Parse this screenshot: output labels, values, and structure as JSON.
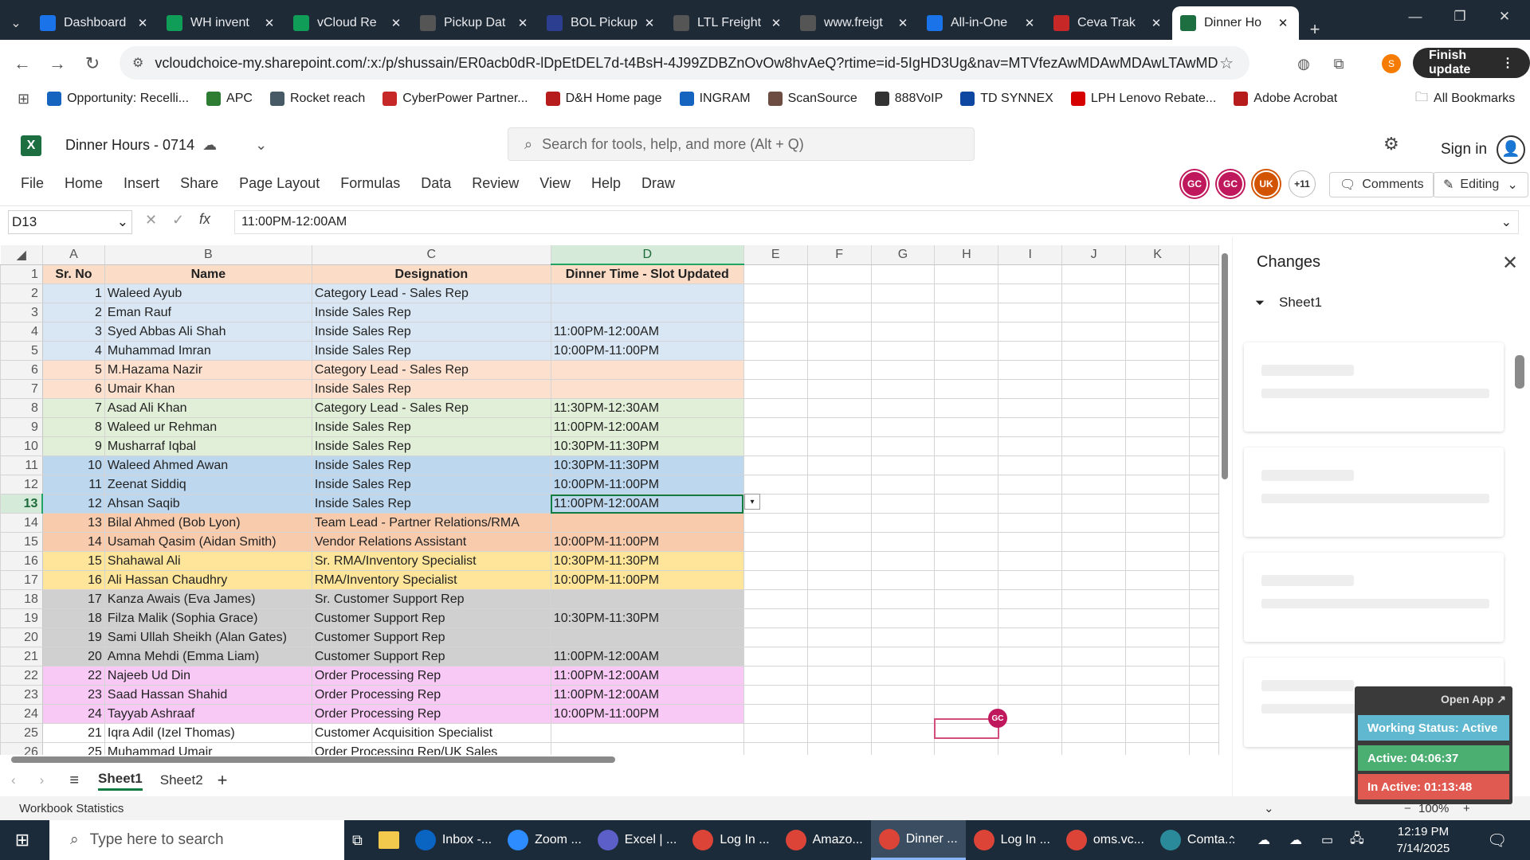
{
  "browser": {
    "tabs": [
      {
        "title": "Dashboard",
        "icon": "dashboard-icon",
        "color": "#1a73e8"
      },
      {
        "title": "WH invent",
        "icon": "sheets-icon",
        "color": "#0f9d58"
      },
      {
        "title": "vCloud Re",
        "icon": "sheets-icon",
        "color": "#0f9d58"
      },
      {
        "title": "Pickup Dat",
        "icon": "globe-icon",
        "color": "#555555"
      },
      {
        "title": "BOL Pickup",
        "icon": "bol-icon",
        "color": "#2c3e90"
      },
      {
        "title": "LTL Freight",
        "icon": "globe-icon",
        "color": "#555555"
      },
      {
        "title": "www.freigt",
        "icon": "fcc-icon",
        "color": "#555555"
      },
      {
        "title": "All-in-One",
        "icon": "seventeen-icon",
        "color": "#1a73e8"
      },
      {
        "title": "Ceva Trak",
        "icon": "ceva-icon",
        "color": "#c62828"
      },
      {
        "title": "Dinner Ho",
        "icon": "excel-icon",
        "color": "#1d6f42"
      }
    ],
    "url": "vcloudchoice-my.sharepoint.com/:x:/p/shussain/ER0acb0dR-lDpEtDEL7d-t4BsH-4J99ZDBZnOvOw8hvAeQ?rtime=id-5IgHD3Ug&nav=MTVfezAwMDAwMDAwLTAwMDEtMA...",
    "finish_update": "Finish update",
    "profile_initial": "S",
    "bookmarks": [
      {
        "label": "Opportunity: Recelli...",
        "color": "#1565c0"
      },
      {
        "label": "APC",
        "color": "#2e7d32"
      },
      {
        "label": "Rocket reach",
        "color": "#455a64"
      },
      {
        "label": "CyberPower Partner...",
        "color": "#c62828"
      },
      {
        "label": "D&H Home page",
        "color": "#b71c1c"
      },
      {
        "label": "INGRAM",
        "color": "#1565c0"
      },
      {
        "label": "ScanSource",
        "color": "#6d4c41"
      },
      {
        "label": "888VoIP",
        "color": "#333333"
      },
      {
        "label": "TD SYNNEX",
        "color": "#0d47a1"
      },
      {
        "label": "LPH Lenovo Rebate...",
        "color": "#d50000"
      },
      {
        "label": "Adobe Acrobat",
        "color": "#b71c1c"
      }
    ],
    "all_bookmarks": "All Bookmarks"
  },
  "excel": {
    "logo": "X",
    "doc_title": "Dinner Hours - 0714",
    "search_placeholder": "Search for tools, help, and more (Alt + Q)",
    "sign_in": "Sign in",
    "menu": [
      "File",
      "Home",
      "Insert",
      "Share",
      "Page Layout",
      "Formulas",
      "Data",
      "Review",
      "View",
      "Help",
      "Draw"
    ],
    "collaborators": [
      {
        "initials": "GC",
        "color": "#c0185c"
      },
      {
        "initials": "GC",
        "color": "#c0185c"
      },
      {
        "initials": "UK",
        "color": "#d35400"
      },
      {
        "initials": "+11",
        "color": "#ffffff"
      }
    ],
    "comments_label": "Comments",
    "editing_label": "Editing",
    "name_box": "D13",
    "formula_value": "11:00PM-12:00AM",
    "columns": [
      "A",
      "B",
      "C",
      "D",
      "E",
      "F",
      "G",
      "H",
      "I",
      "J",
      "K"
    ],
    "header_row": {
      "a": "Sr. No",
      "b": "Name",
      "c": "Designation",
      "d": "Dinner Time - Slot Updated"
    },
    "rows": [
      {
        "r": 2,
        "a": "1",
        "b": "Waleed Ayub",
        "c": "Category Lead - Sales Rep",
        "d": "",
        "color": "blue"
      },
      {
        "r": 3,
        "a": "2",
        "b": "Eman Rauf",
        "c": "Inside Sales Rep",
        "d": "",
        "color": "blue"
      },
      {
        "r": 4,
        "a": "3",
        "b": "Syed Abbas Ali Shah",
        "c": "Inside Sales Rep",
        "d": "11:00PM-12:00AM",
        "color": "blue"
      },
      {
        "r": 5,
        "a": "4",
        "b": "Muhammad Imran",
        "c": "Inside Sales Rep",
        "d": "10:00PM-11:00PM",
        "color": "blue"
      },
      {
        "r": 6,
        "a": "5",
        "b": "M.Hazama Nazir",
        "c": "Category Lead - Sales Rep",
        "d": "",
        "color": "peach"
      },
      {
        "r": 7,
        "a": "6",
        "b": "Umair Khan",
        "c": "Inside Sales Rep",
        "d": "",
        "color": "peach"
      },
      {
        "r": 8,
        "a": "7",
        "b": "Asad Ali Khan",
        "c": "Category Lead - Sales Rep",
        "d": "11:30PM-12:30AM",
        "color": "green"
      },
      {
        "r": 9,
        "a": "8",
        "b": "Waleed ur Rehman",
        "c": "Inside Sales Rep",
        "d": "11:00PM-12:00AM",
        "color": "green"
      },
      {
        "r": 10,
        "a": "9",
        "b": "Musharraf Iqbal",
        "c": "Inside Sales Rep",
        "d": "10:30PM-11:30PM",
        "color": "green"
      },
      {
        "r": 11,
        "a": "10",
        "b": "Waleed Ahmed Awan",
        "c": "Inside Sales Rep",
        "d": "10:30PM-11:30PM",
        "color": "darkblue"
      },
      {
        "r": 12,
        "a": "11",
        "b": "Zeenat Siddiq",
        "c": "Inside Sales Rep",
        "d": "10:00PM-11:00PM",
        "color": "darkblue"
      },
      {
        "r": 13,
        "a": "12",
        "b": "Ahsan Saqib",
        "c": "Inside Sales Rep",
        "d": "11:00PM-12:00AM",
        "color": "darkblue"
      },
      {
        "r": 14,
        "a": "13",
        "b": "Bilal Ahmed (Bob Lyon)",
        "c": "Team Lead - Partner Relations/RMA",
        "d": "",
        "color": "orange"
      },
      {
        "r": 15,
        "a": "14",
        "b": "Usamah Qasim (Aidan Smith)",
        "c": "Vendor Relations Assistant",
        "d": "10:00PM-11:00PM",
        "color": "orange"
      },
      {
        "r": 16,
        "a": "15",
        "b": "Shahawal Ali",
        "c": "Sr. RMA/Inventory Specialist",
        "d": "10:30PM-11:30PM",
        "color": "yellow"
      },
      {
        "r": 17,
        "a": "16",
        "b": "Ali Hassan Chaudhry",
        "c": "RMA/Inventory Specialist",
        "d": "10:00PM-11:00PM",
        "color": "yellow"
      },
      {
        "r": 18,
        "a": "17",
        "b": "Kanza Awais (Eva James)",
        "c": "Sr. Customer Support Rep",
        "d": "",
        "color": "gray"
      },
      {
        "r": 19,
        "a": "18",
        "b": "Filza Malik (Sophia Grace)",
        "c": "Customer Support Rep",
        "d": "10:30PM-11:30PM",
        "color": "gray"
      },
      {
        "r": 20,
        "a": "19",
        "b": "Sami Ullah Sheikh (Alan Gates)",
        "c": "Customer Support Rep",
        "d": "",
        "color": "gray"
      },
      {
        "r": 21,
        "a": "20",
        "b": "Amna Mehdi (Emma Liam)",
        "c": "Customer Support Rep",
        "d": "11:00PM-12:00AM",
        "color": "gray"
      },
      {
        "r": 22,
        "a": "22",
        "b": "Najeeb Ud Din",
        "c": "Order Processing Rep",
        "d": "11:00PM-12:00AM",
        "color": "pink"
      },
      {
        "r": 23,
        "a": "23",
        "b": "Saad Hassan Shahid",
        "c": "Order Processing Rep",
        "d": "11:00PM-12:00AM",
        "color": "pink"
      },
      {
        "r": 24,
        "a": "24",
        "b": "Tayyab Ashraaf",
        "c": "Order Processing Rep",
        "d": "10:00PM-11:00PM",
        "color": "pink"
      },
      {
        "r": 25,
        "a": "21",
        "b": "Iqra Adil (Izel Thomas)",
        "c": "Customer Acquisition Specialist",
        "d": "",
        "color": "white"
      },
      {
        "r": 26,
        "a": "25",
        "b": "Muhammad Umair",
        "c": "Order Processing Rep/UK Sales",
        "d": "",
        "color": "white"
      }
    ],
    "selected_row": 13,
    "sheets": [
      "Sheet1",
      "Sheet2"
    ],
    "status_left": "Workbook Statistics",
    "zoom": "100%",
    "cell_marker": "GC"
  },
  "changes_panel": {
    "title": "Changes",
    "filter_label": "Sheet1"
  },
  "status_widget": {
    "open_app": "Open App ↗",
    "working": "Working Status: Active",
    "active": "Active: 04:06:37",
    "inactive": "In Active: 01:13:48"
  },
  "taskbar": {
    "search_placeholder": "Type here to search",
    "apps": [
      {
        "label": "Inbox -...",
        "icon": "outlook-icon",
        "color": "#0a64c2"
      },
      {
        "label": "Zoom ...",
        "icon": "zoom-icon",
        "color": "#2d8cff"
      },
      {
        "label": "Excel | ...",
        "icon": "teams-icon",
        "color": "#5b5fc7"
      },
      {
        "label": "Log In ...",
        "icon": "chrome-icon",
        "color": "#db4437"
      },
      {
        "label": "Amazo...",
        "icon": "chrome-icon",
        "color": "#db4437"
      },
      {
        "label": "Dinner ...",
        "icon": "chrome-icon",
        "color": "#db4437"
      },
      {
        "label": "Log In ...",
        "icon": "chrome-icon",
        "color": "#db4437"
      },
      {
        "label": "oms.vc...",
        "icon": "chrome-icon",
        "color": "#db4437"
      },
      {
        "label": "Comta...",
        "icon": "comtrac-icon",
        "color": "#2b8a9a"
      }
    ],
    "active_app": 5,
    "time": "12:19 PM",
    "date": "7/14/2025"
  }
}
